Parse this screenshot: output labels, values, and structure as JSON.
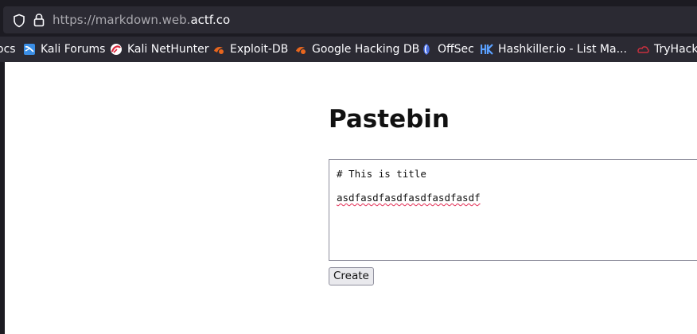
{
  "urlbar": {
    "url_prefix": "https://markdown.web.",
    "url_host": "actf.co"
  },
  "bookmarks": [
    {
      "label": "ocs",
      "icon": "doc-icon"
    },
    {
      "label": "Kali Forums",
      "icon": "kali-forums-icon"
    },
    {
      "label": "Kali NetHunter",
      "icon": "kali-nethunter-icon"
    },
    {
      "label": "Exploit-DB",
      "icon": "exploit-db-icon"
    },
    {
      "label": "Google Hacking DB",
      "icon": "ghdb-icon"
    },
    {
      "label": "OffSec",
      "icon": "offsec-icon"
    },
    {
      "label": "Hashkiller.io - List Ma...",
      "icon": "hashkiller-icon"
    },
    {
      "label": "TryHackM",
      "icon": "tryhackme-icon"
    }
  ],
  "page": {
    "title": "Pastebin",
    "editor_line1": "# This is title",
    "editor_line2": "asdfasdfasdfasdfasdfasdf",
    "create_label": "Create"
  },
  "colors": {
    "browser_bg": "#1c1b22",
    "toolbar_bg": "#2b2a33",
    "spellcheck": "#e22850"
  }
}
